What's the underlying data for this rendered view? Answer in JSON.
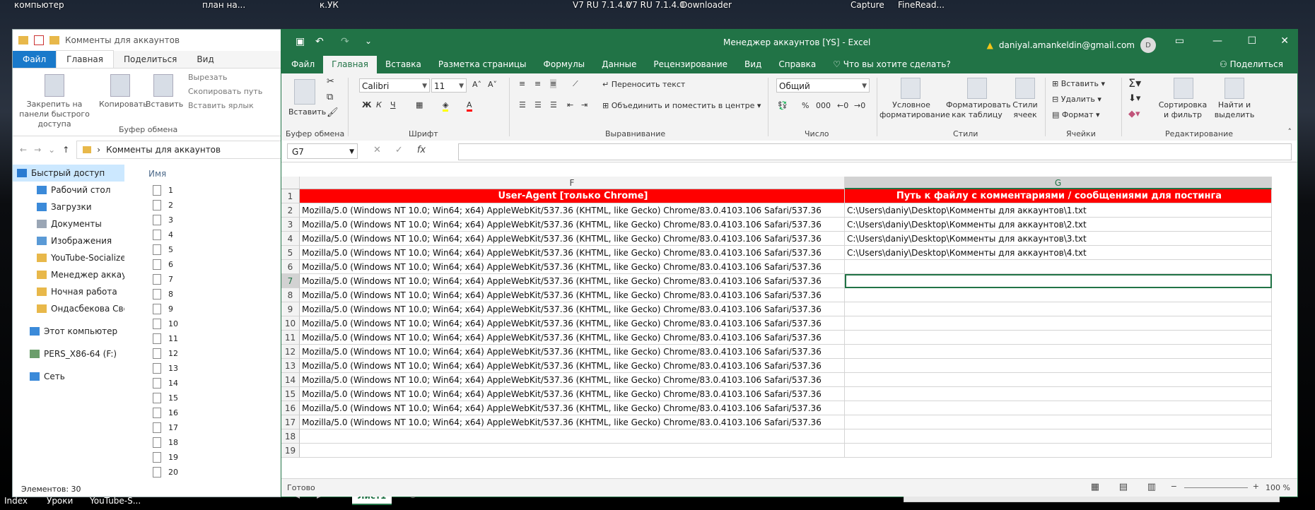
{
  "desktop": {
    "top_labels": [
      "компьютер",
      "план на...",
      "к.УК",
      "V7 RU 7.1.4.0",
      "V7 RU 7.1.4.0",
      "Downloader",
      "Capture",
      "FineRead..."
    ],
    "bottom_labels": [
      "Index",
      "Уроки",
      "YouTube-S..."
    ]
  },
  "explorer": {
    "title": "Комменты для аккаунтов",
    "tabs": [
      "Файл",
      "Главная",
      "Поделиться",
      "Вид"
    ],
    "ribbon": {
      "pin": "Закрепить на панели быстрого доступа",
      "copy": "Копировать",
      "paste": "Вставить",
      "cut": "Вырезать",
      "copy_path": "Скопировать путь",
      "paste_shortcut": "Вставить ярлык",
      "group": "Буфер обмена"
    },
    "address": "Комменты для аккаунтов",
    "column_name": "Имя",
    "nav": [
      {
        "label": "Быстрый доступ"
      },
      {
        "label": "Рабочий стол"
      },
      {
        "label": "Загрузки"
      },
      {
        "label": "Документы"
      },
      {
        "label": "Изображения"
      },
      {
        "label": "YouTube-Socializer"
      },
      {
        "label": "Менеджер аккаунт"
      },
      {
        "label": "Ночная работа"
      },
      {
        "label": "Ондасбекова Свет"
      },
      {
        "label": "Этот компьютер"
      },
      {
        "label": "PERS_X86-64 (F:)"
      },
      {
        "label": "Сеть"
      }
    ],
    "files": [
      "1",
      "2",
      "3",
      "4",
      "5",
      "6",
      "7",
      "8",
      "9",
      "10",
      "11",
      "12",
      "13",
      "14",
      "15",
      "16",
      "17",
      "18",
      "19",
      "20"
    ],
    "status": "Элементов: 30"
  },
  "excel": {
    "doc_title": "Менеджер аккаунтов [YS]  -  Excel",
    "account": "daniyal.amankeldin@gmail.com",
    "avatar": "D",
    "tabs": [
      "Файл",
      "Главная",
      "Вставка",
      "Разметка страницы",
      "Формулы",
      "Данные",
      "Рецензирование",
      "Вид",
      "Справка"
    ],
    "tell_me": "Что вы хотите сделать?",
    "share": "Поделиться",
    "ribbon": {
      "paste": "Вставить",
      "clipboard": "Буфер обмена",
      "font_name": "Calibri",
      "font_size": "11",
      "font_group": "Шрифт",
      "wrap": "Переносить текст",
      "merge": "Объединить и поместить в центре",
      "align_group": "Выравнивание",
      "number_format": "Общий",
      "number_group": "Число",
      "cond_format": "Условное форматирование",
      "format_table": "Форматировать как таблицу",
      "cell_styles": "Стили ячеек",
      "styles_group": "Стили",
      "insert": "Вставить",
      "delete": "Удалить",
      "format": "Формат",
      "cells_group": "Ячейки",
      "sort": "Сортировка и фильтр",
      "find": "Найти и выделить",
      "edit_group": "Редактирование"
    },
    "name_box": "G7",
    "columns": {
      "F": "F",
      "G": "G"
    },
    "header_f": "User-Agent [только Chrome]",
    "header_g": "Путь к файлу с комментариями / сообщениями для постинга",
    "rows": [
      {
        "n": "1"
      },
      {
        "n": "2",
        "f": "Mozilla/5.0 (Windows NT 10.0; Win64; x64) AppleWebKit/537.36 (KHTML, like Gecko) Chrome/83.0.4103.106 Safari/537.36",
        "g": "C:\\Users\\daniy\\Desktop\\Комменты для аккаунтов\\1.txt"
      },
      {
        "n": "3",
        "f": "Mozilla/5.0 (Windows NT 10.0; Win64; x64) AppleWebKit/537.36 (KHTML, like Gecko) Chrome/83.0.4103.106 Safari/537.36",
        "g": "C:\\Users\\daniy\\Desktop\\Комменты для аккаунтов\\2.txt"
      },
      {
        "n": "4",
        "f": "Mozilla/5.0 (Windows NT 10.0; Win64; x64) AppleWebKit/537.36 (KHTML, like Gecko) Chrome/83.0.4103.106 Safari/537.36",
        "g": "C:\\Users\\daniy\\Desktop\\Комменты для аккаунтов\\3.txt"
      },
      {
        "n": "5",
        "f": "Mozilla/5.0 (Windows NT 10.0; Win64; x64) AppleWebKit/537.36 (KHTML, like Gecko) Chrome/83.0.4103.106 Safari/537.36",
        "g": "C:\\Users\\daniy\\Desktop\\Комменты для аккаунтов\\4.txt"
      },
      {
        "n": "6",
        "f": "Mozilla/5.0 (Windows NT 10.0; Win64; x64) AppleWebKit/537.36 (KHTML, like Gecko) Chrome/83.0.4103.106 Safari/537.36",
        "g": ""
      },
      {
        "n": "7",
        "f": "Mozilla/5.0 (Windows NT 10.0; Win64; x64) AppleWebKit/537.36 (KHTML, like Gecko) Chrome/83.0.4103.106 Safari/537.36",
        "g": ""
      },
      {
        "n": "8",
        "f": "Mozilla/5.0 (Windows NT 10.0; Win64; x64) AppleWebKit/537.36 (KHTML, like Gecko) Chrome/83.0.4103.106 Safari/537.36",
        "g": ""
      },
      {
        "n": "9",
        "f": "Mozilla/5.0 (Windows NT 10.0; Win64; x64) AppleWebKit/537.36 (KHTML, like Gecko) Chrome/83.0.4103.106 Safari/537.36",
        "g": ""
      },
      {
        "n": "10",
        "f": "Mozilla/5.0 (Windows NT 10.0; Win64; x64) AppleWebKit/537.36 (KHTML, like Gecko) Chrome/83.0.4103.106 Safari/537.36",
        "g": ""
      },
      {
        "n": "11",
        "f": "Mozilla/5.0 (Windows NT 10.0; Win64; x64) AppleWebKit/537.36 (KHTML, like Gecko) Chrome/83.0.4103.106 Safari/537.36",
        "g": ""
      },
      {
        "n": "12",
        "f": "Mozilla/5.0 (Windows NT 10.0; Win64; x64) AppleWebKit/537.36 (KHTML, like Gecko) Chrome/83.0.4103.106 Safari/537.36",
        "g": ""
      },
      {
        "n": "13",
        "f": "Mozilla/5.0 (Windows NT 10.0; Win64; x64) AppleWebKit/537.36 (KHTML, like Gecko) Chrome/83.0.4103.106 Safari/537.36",
        "g": ""
      },
      {
        "n": "14",
        "f": "Mozilla/5.0 (Windows NT 10.0; Win64; x64) AppleWebKit/537.36 (KHTML, like Gecko) Chrome/83.0.4103.106 Safari/537.36",
        "g": ""
      },
      {
        "n": "15",
        "f": "Mozilla/5.0 (Windows NT 10.0; Win64; x64) AppleWebKit/537.36 (KHTML, like Gecko) Chrome/83.0.4103.106 Safari/537.36",
        "g": ""
      },
      {
        "n": "16",
        "f": "Mozilla/5.0 (Windows NT 10.0; Win64; x64) AppleWebKit/537.36 (KHTML, like Gecko) Chrome/83.0.4103.106 Safari/537.36",
        "g": ""
      },
      {
        "n": "17",
        "f": "Mozilla/5.0 (Windows NT 10.0; Win64; x64) AppleWebKit/537.36 (KHTML, like Gecko) Chrome/83.0.4103.106 Safari/537.36",
        "g": ""
      },
      {
        "n": "18",
        "f": "",
        "g": ""
      },
      {
        "n": "19",
        "f": "",
        "g": ""
      }
    ],
    "sheet": "Лист1",
    "status": "Готово",
    "zoom": "100 %",
    "colors": {
      "accent": "#217346",
      "header_fill": "#ff0000"
    }
  }
}
